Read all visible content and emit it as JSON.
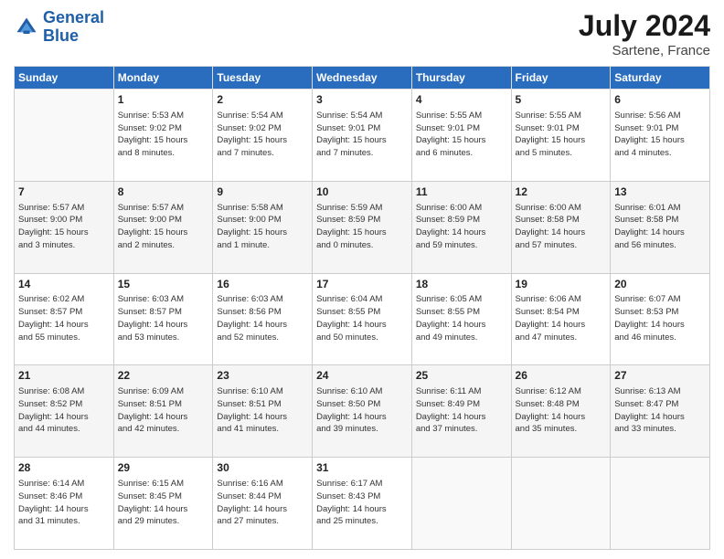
{
  "header": {
    "logo_line1": "General",
    "logo_line2": "Blue",
    "month_year": "July 2024",
    "location": "Sartene, France"
  },
  "days_of_week": [
    "Sunday",
    "Monday",
    "Tuesday",
    "Wednesday",
    "Thursday",
    "Friday",
    "Saturday"
  ],
  "weeks": [
    [
      {
        "day": "",
        "info": ""
      },
      {
        "day": "1",
        "info": "Sunrise: 5:53 AM\nSunset: 9:02 PM\nDaylight: 15 hours\nand 8 minutes."
      },
      {
        "day": "2",
        "info": "Sunrise: 5:54 AM\nSunset: 9:02 PM\nDaylight: 15 hours\nand 7 minutes."
      },
      {
        "day": "3",
        "info": "Sunrise: 5:54 AM\nSunset: 9:01 PM\nDaylight: 15 hours\nand 7 minutes."
      },
      {
        "day": "4",
        "info": "Sunrise: 5:55 AM\nSunset: 9:01 PM\nDaylight: 15 hours\nand 6 minutes."
      },
      {
        "day": "5",
        "info": "Sunrise: 5:55 AM\nSunset: 9:01 PM\nDaylight: 15 hours\nand 5 minutes."
      },
      {
        "day": "6",
        "info": "Sunrise: 5:56 AM\nSunset: 9:01 PM\nDaylight: 15 hours\nand 4 minutes."
      }
    ],
    [
      {
        "day": "7",
        "info": "Sunrise: 5:57 AM\nSunset: 9:00 PM\nDaylight: 15 hours\nand 3 minutes."
      },
      {
        "day": "8",
        "info": "Sunrise: 5:57 AM\nSunset: 9:00 PM\nDaylight: 15 hours\nand 2 minutes."
      },
      {
        "day": "9",
        "info": "Sunrise: 5:58 AM\nSunset: 9:00 PM\nDaylight: 15 hours\nand 1 minute."
      },
      {
        "day": "10",
        "info": "Sunrise: 5:59 AM\nSunset: 8:59 PM\nDaylight: 15 hours\nand 0 minutes."
      },
      {
        "day": "11",
        "info": "Sunrise: 6:00 AM\nSunset: 8:59 PM\nDaylight: 14 hours\nand 59 minutes."
      },
      {
        "day": "12",
        "info": "Sunrise: 6:00 AM\nSunset: 8:58 PM\nDaylight: 14 hours\nand 57 minutes."
      },
      {
        "day": "13",
        "info": "Sunrise: 6:01 AM\nSunset: 8:58 PM\nDaylight: 14 hours\nand 56 minutes."
      }
    ],
    [
      {
        "day": "14",
        "info": "Sunrise: 6:02 AM\nSunset: 8:57 PM\nDaylight: 14 hours\nand 55 minutes."
      },
      {
        "day": "15",
        "info": "Sunrise: 6:03 AM\nSunset: 8:57 PM\nDaylight: 14 hours\nand 53 minutes."
      },
      {
        "day": "16",
        "info": "Sunrise: 6:03 AM\nSunset: 8:56 PM\nDaylight: 14 hours\nand 52 minutes."
      },
      {
        "day": "17",
        "info": "Sunrise: 6:04 AM\nSunset: 8:55 PM\nDaylight: 14 hours\nand 50 minutes."
      },
      {
        "day": "18",
        "info": "Sunrise: 6:05 AM\nSunset: 8:55 PM\nDaylight: 14 hours\nand 49 minutes."
      },
      {
        "day": "19",
        "info": "Sunrise: 6:06 AM\nSunset: 8:54 PM\nDaylight: 14 hours\nand 47 minutes."
      },
      {
        "day": "20",
        "info": "Sunrise: 6:07 AM\nSunset: 8:53 PM\nDaylight: 14 hours\nand 46 minutes."
      }
    ],
    [
      {
        "day": "21",
        "info": "Sunrise: 6:08 AM\nSunset: 8:52 PM\nDaylight: 14 hours\nand 44 minutes."
      },
      {
        "day": "22",
        "info": "Sunrise: 6:09 AM\nSunset: 8:51 PM\nDaylight: 14 hours\nand 42 minutes."
      },
      {
        "day": "23",
        "info": "Sunrise: 6:10 AM\nSunset: 8:51 PM\nDaylight: 14 hours\nand 41 minutes."
      },
      {
        "day": "24",
        "info": "Sunrise: 6:10 AM\nSunset: 8:50 PM\nDaylight: 14 hours\nand 39 minutes."
      },
      {
        "day": "25",
        "info": "Sunrise: 6:11 AM\nSunset: 8:49 PM\nDaylight: 14 hours\nand 37 minutes."
      },
      {
        "day": "26",
        "info": "Sunrise: 6:12 AM\nSunset: 8:48 PM\nDaylight: 14 hours\nand 35 minutes."
      },
      {
        "day": "27",
        "info": "Sunrise: 6:13 AM\nSunset: 8:47 PM\nDaylight: 14 hours\nand 33 minutes."
      }
    ],
    [
      {
        "day": "28",
        "info": "Sunrise: 6:14 AM\nSunset: 8:46 PM\nDaylight: 14 hours\nand 31 minutes."
      },
      {
        "day": "29",
        "info": "Sunrise: 6:15 AM\nSunset: 8:45 PM\nDaylight: 14 hours\nand 29 minutes."
      },
      {
        "day": "30",
        "info": "Sunrise: 6:16 AM\nSunset: 8:44 PM\nDaylight: 14 hours\nand 27 minutes."
      },
      {
        "day": "31",
        "info": "Sunrise: 6:17 AM\nSunset: 8:43 PM\nDaylight: 14 hours\nand 25 minutes."
      },
      {
        "day": "",
        "info": ""
      },
      {
        "day": "",
        "info": ""
      },
      {
        "day": "",
        "info": ""
      }
    ]
  ]
}
